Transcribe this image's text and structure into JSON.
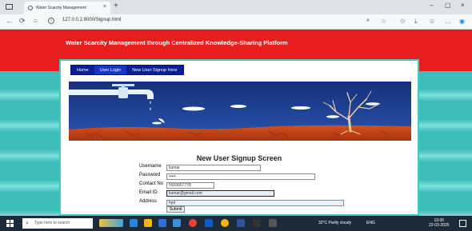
{
  "browser": {
    "tab_title": "Water Scarcity Management",
    "tab_close": "×",
    "new_tab": "+",
    "url": "127.0.0.1:8000/Signup.html",
    "window_controls": [
      "–",
      "▢",
      "×"
    ]
  },
  "site": {
    "title": "Water Scarcity Management through Centralized Knowledge-Sharing Platform",
    "nav": [
      {
        "label": "Home"
      },
      {
        "label": "User Login"
      },
      {
        "label": "New User Signup Here"
      }
    ],
    "banner_colors": {
      "sky": "#1b3a8c",
      "ground": "#c9441c",
      "tap": "#e8f4fb",
      "tree": "#e9c9a2"
    }
  },
  "form": {
    "title": "New User Signup Screen",
    "fields": [
      {
        "label": "Username",
        "value": "kumar"
      },
      {
        "label": "Password",
        "value": "•••••"
      },
      {
        "label": "Contact No",
        "value": "5555667778"
      },
      {
        "label": "Email ID",
        "value": "kumar@gmail.com"
      },
      {
        "label": "Address",
        "value": "hyd"
      }
    ],
    "submit_label": "Submit"
  },
  "taskbar": {
    "search_placeholder": "Type here to search",
    "weather": "32°C  Partly cloudy",
    "tray": "ENG",
    "time": "19:06",
    "date": "22-03-2025"
  },
  "colors": {
    "header_red": "#e81d1d",
    "nav_blue": "#0a1f96",
    "page_teal": "#3ec3c0"
  }
}
